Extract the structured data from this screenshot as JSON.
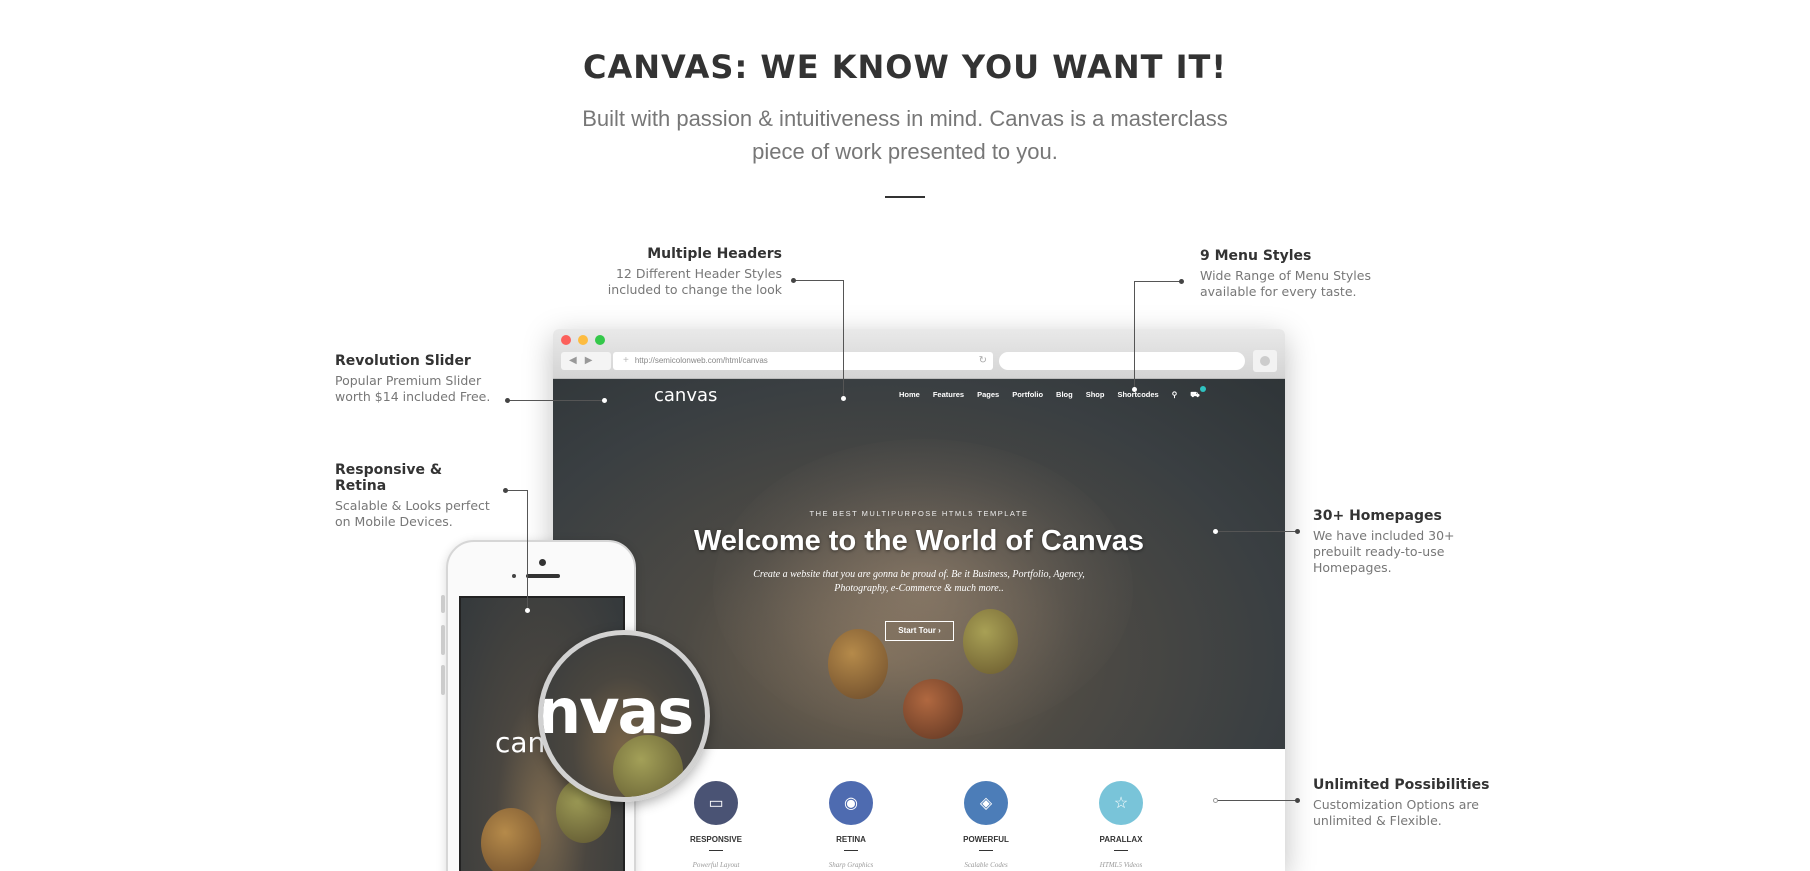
{
  "heading": {
    "title": "CANVAS: WE KNOW YOU WANT IT!",
    "subtitle": "Built with passion & intuitiveness in mind. Canvas is a masterclass piece of work presented to you."
  },
  "callouts": {
    "multiple_headers": {
      "title": "Multiple Headers",
      "desc": "12 Different Header Styles included to change the look"
    },
    "menu_styles": {
      "title": "9 Menu Styles",
      "desc": "Wide Range of Menu Styles available for every taste."
    },
    "revolution_slider": {
      "title": "Revolution Slider",
      "desc": "Popular Premium Slider worth $14 included Free."
    },
    "responsive_retina": {
      "title": "Responsive & Retina",
      "desc": "Scalable & Looks perfect on Mobile Devices."
    },
    "homepages": {
      "title": "30+ Homepages",
      "desc": "We have included 30+ prebuilt ready-to-use Homepages."
    },
    "unlimited": {
      "title": "Unlimited Possibilities",
      "desc": "Customization Options are unlimited & Flexible."
    }
  },
  "browser": {
    "url": "http://semicolonweb.com/html/canvas",
    "traffic_colors": [
      "#fc605b",
      "#fdbc40",
      "#34c84a"
    ]
  },
  "site": {
    "logo": "canvas",
    "nav": [
      "Home",
      "Features",
      "Pages",
      "Portfolio",
      "Blog",
      "Shop",
      "Shortcodes"
    ],
    "tagline": "THE BEST MULTIPURPOSE HTML5 TEMPLATE",
    "title": "Welcome to the World of Canvas",
    "description": "Create a website that you are gonna be proud of. Be it Business, Portfolio, Agency, Photography, e-Commerce & much more..",
    "button": "Start Tour ›",
    "features": [
      {
        "label": "RESPONSIVE",
        "sub": "Powerful Layout",
        "icon": "monitor-icon",
        "color": "#4a5374"
      },
      {
        "label": "RETINA",
        "sub": "Sharp Graphics",
        "icon": "eye-icon",
        "color": "#4e6bb0"
      },
      {
        "label": "POWERFUL",
        "sub": "Scalable Codes",
        "icon": "layers-icon",
        "color": "#4c7db8"
      },
      {
        "label": "PARALLAX",
        "sub": "HTML5 Videos",
        "icon": "star-icon",
        "color": "#79c4d9"
      }
    ]
  },
  "phone": {
    "logo": "canvas",
    "magnified_text": "nvas"
  }
}
